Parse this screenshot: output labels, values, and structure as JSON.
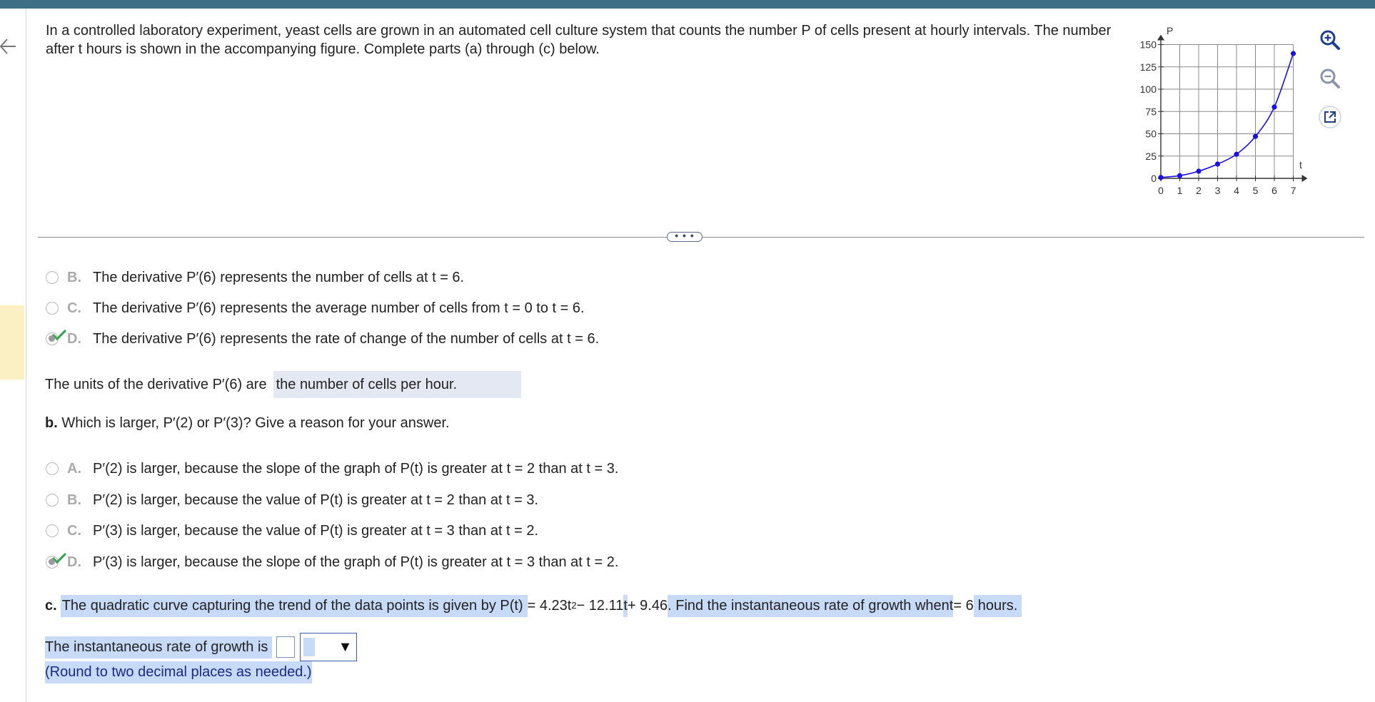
{
  "question": {
    "prompt": "In a controlled laboratory experiment, yeast cells are grown in an automated cell culture system that counts the number P of cells present at hourly intervals. The number after t hours is shown in the accompanying figure. Complete parts (a) through (c) below."
  },
  "graph": {
    "y_axis_label": "P",
    "x_axis_label": "t",
    "y_ticks": [
      "150",
      "125",
      "100",
      "75",
      "50",
      "25",
      "0"
    ],
    "x_ticks": [
      "0",
      "1",
      "2",
      "3",
      "4",
      "5",
      "6",
      "7"
    ],
    "points": [
      {
        "t": 0,
        "P": 1
      },
      {
        "t": 1,
        "P": 3
      },
      {
        "t": 2,
        "P": 8
      },
      {
        "t": 3,
        "P": 16
      },
      {
        "t": 4,
        "P": 27
      },
      {
        "t": 5,
        "P": 47
      },
      {
        "t": 6,
        "P": 80
      },
      {
        "t": 7,
        "P": 140
      }
    ],
    "curve_color": "#1a10e0"
  },
  "tools": {
    "zoom_in_icon": "zoom-in-icon",
    "zoom_out_icon": "zoom-out-icon",
    "popout_icon": "popout-icon"
  },
  "more_button": "• • •",
  "part_a": {
    "options": [
      {
        "letter": "B.",
        "text": "The derivative P′(6) represents the number of cells at t = 6.",
        "selected": false
      },
      {
        "letter": "C.",
        "text": "The derivative P′(6) represents the average number of cells from t = 0 to t = 6.",
        "selected": false
      },
      {
        "letter": "D.",
        "text": "The derivative P′(6) represents the rate of change of the number of cells at t = 6.",
        "selected": true
      }
    ],
    "units_prompt": "The units of the derivative P′(6) are",
    "units_answer": "the number of cells per hour."
  },
  "part_b": {
    "label": "b.",
    "question": "Which is larger, P′(2) or P′(3)? Give a reason for your answer.",
    "options": [
      {
        "letter": "A.",
        "text": "P′(2) is larger, because the slope of the graph of P(t) is greater at t = 2 than at t = 3.",
        "selected": false
      },
      {
        "letter": "B.",
        "text": "P′(2) is larger, because the value of P(t) is greater at t = 2 than at t = 3.",
        "selected": false
      },
      {
        "letter": "C.",
        "text": "P′(3) is larger, because the value of P(t) is greater at t = 3 than at t = 2.",
        "selected": false
      },
      {
        "letter": "D.",
        "text": "P′(3) is larger, because the slope of the graph of P(t) is greater at t = 3 than at t = 2.",
        "selected": true
      }
    ]
  },
  "part_c": {
    "label": "c.",
    "text_1": "The quadratic curve capturing the trend of the data points is given by P(t)",
    "equation_a": " = 4.23t",
    "exponent": "2",
    "equation_b": " − 12.11",
    "equation_t": "t",
    "equation_c": " + 9.46",
    "text_2": ". Find the instantaneous rate of growth when ",
    "t_var": "t",
    "t_value": " = 6",
    "text_3": " hours.",
    "answer_prompt": "The instantaneous rate of growth is",
    "answer_value": "",
    "select_arrow": "▼",
    "round_note": "(Round to two decimal places as needed.)"
  },
  "colors": {
    "top_bar": "#3d6f86",
    "highlight": "#c7daf7",
    "check_green": "#3aa655",
    "units_answer_bg": "#e4e8f2"
  }
}
